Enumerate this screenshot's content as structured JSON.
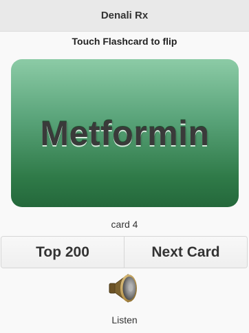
{
  "header": {
    "title": "Denali Rx"
  },
  "instruction": "Touch Flashcard to flip",
  "flashcard": {
    "word": "Metformin"
  },
  "counter": "card 4",
  "buttons": {
    "top200": "Top 200",
    "next": "Next Card"
  },
  "listen": {
    "label": "Listen",
    "icon": "speaker-icon"
  },
  "colors": {
    "card_top": "#8ccba6",
    "card_bottom": "#24683b",
    "header_bg": "#e9e9e9"
  }
}
